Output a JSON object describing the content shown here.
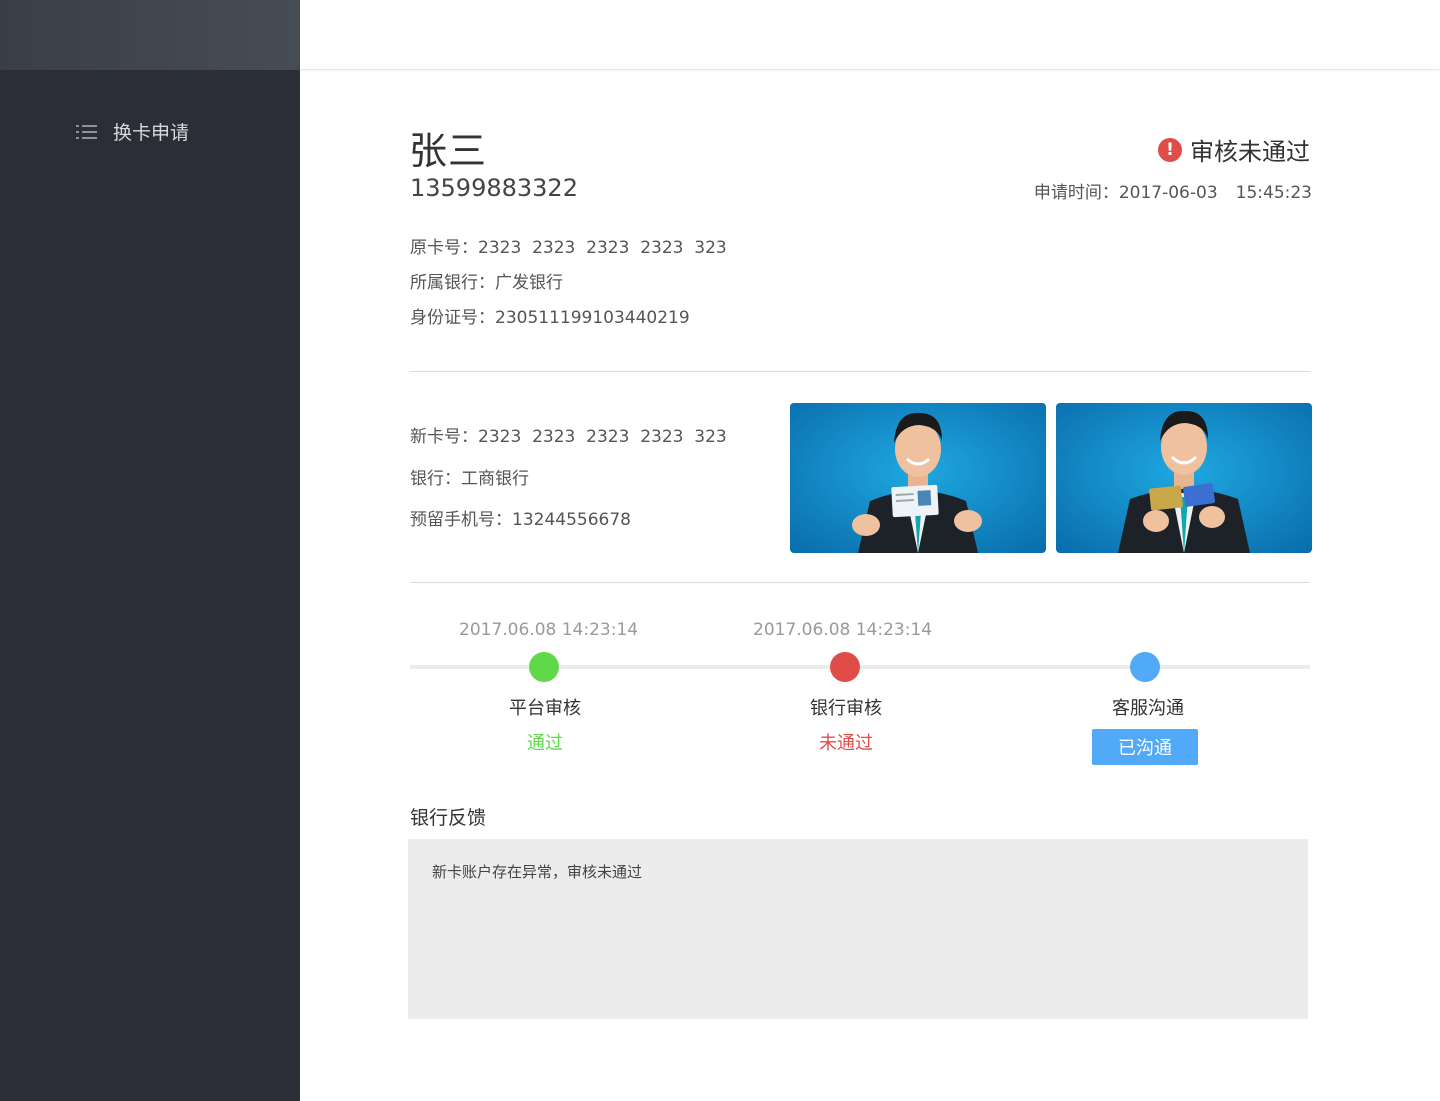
{
  "sidebar": {
    "nav_item_label": "换卡申请",
    "nav_icon": "list-icon"
  },
  "applicant": {
    "name": "张三",
    "phone": "13599883322"
  },
  "status": {
    "icon": "exclamation-circle-icon",
    "text": "审核未通过",
    "color": "#e04d48"
  },
  "apply_time": {
    "label": "申请时间：",
    "date": "2017-06-03",
    "time": "15:45:23"
  },
  "old_card": {
    "card_label": "原卡号：",
    "card_number": "2323  2323  2323  2323  323",
    "bank_label": "所属银行：",
    "bank": "广发银行",
    "id_label": "身份证号：",
    "id_number": "230511199103440219"
  },
  "new_card": {
    "card_label": "新卡号：",
    "card_number": "2323  2323  2323  2323  323",
    "bank_label": "银行：",
    "bank": "工商银行",
    "phone_label": "预留手机号：",
    "phone": "13244556678"
  },
  "photos": [
    {
      "name": "id-card-photo",
      "description_icon": "man-holding-id-card"
    },
    {
      "name": "bank-card-photo",
      "description_icon": "man-holding-bank-cards"
    }
  ],
  "progress": {
    "steps": [
      {
        "time": "2017.06.08 14:23:14",
        "label": "平台审核",
        "result": "通过",
        "color": "#5fd94a"
      },
      {
        "time": "2017.06.08 14:23:14",
        "label": "银行审核",
        "result": "未通过",
        "color": "#e04d48"
      },
      {
        "time": "",
        "label": "客服沟通",
        "result": "已沟通",
        "color": "#51a9f7"
      }
    ]
  },
  "feedback": {
    "title": "银行反馈",
    "text": "新卡账户存在异常，审核未通过"
  }
}
